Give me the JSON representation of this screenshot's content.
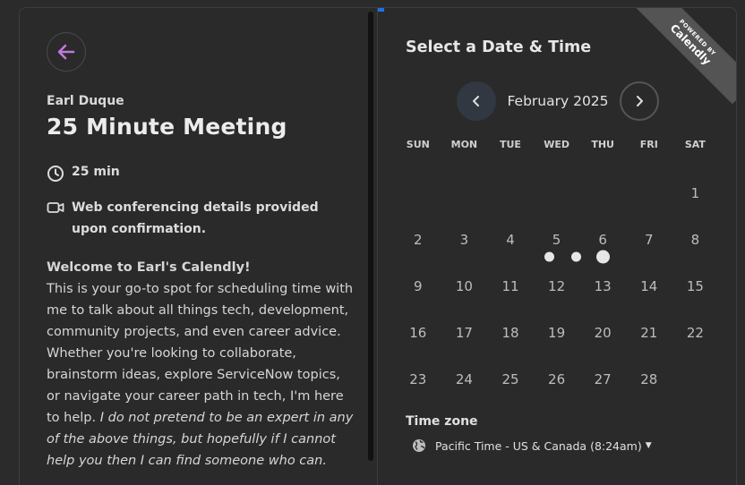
{
  "colors": {
    "accent": "#c07ad8",
    "loading_marker": "#1a73e8",
    "ribbon": "#545454"
  },
  "event": {
    "host_name": "Earl Duque",
    "title": "25 Minute Meeting",
    "duration": "25 min",
    "conferencing": "Web conferencing details provided upon confirmation.",
    "description_heading": "Welcome to Earl's Calendly!",
    "description_body": "This is your go-to spot for scheduling time with me to talk about all things tech, development, community projects, and even career advice. Whether you're looking to collaborate, brainstorm ideas, explore ServiceNow topics, or navigate your career path in tech, I'm here to help.",
    "description_italic": "I do not pretend to be an expert in any of the above things, but hopefully if I cannot help you then I can find someone who can."
  },
  "icons": {
    "back": "arrow-left-icon",
    "duration": "clock-icon",
    "conferencing": "video-camera-icon",
    "timezone": "globe-icon",
    "prev": "chevron-left-icon",
    "next": "chevron-right-icon"
  },
  "scheduler": {
    "title": "Select a Date & Time",
    "month_label": "February 2025",
    "weekdays": [
      "SUN",
      "MON",
      "TUE",
      "WED",
      "THU",
      "FRI",
      "SAT"
    ],
    "leading_blank_days": 6,
    "days": [
      "1",
      "2",
      "3",
      "4",
      "5",
      "6",
      "7",
      "8",
      "9",
      "10",
      "11",
      "12",
      "13",
      "14",
      "15",
      "16",
      "17",
      "18",
      "19",
      "20",
      "21",
      "22",
      "23",
      "24",
      "25",
      "26",
      "27",
      "28"
    ]
  },
  "badge": {
    "line1": "POWERED BY",
    "line2": "Calendly"
  },
  "timezone": {
    "title": "Time zone",
    "value": "Pacific Time - US & Canada (8:24am)"
  }
}
